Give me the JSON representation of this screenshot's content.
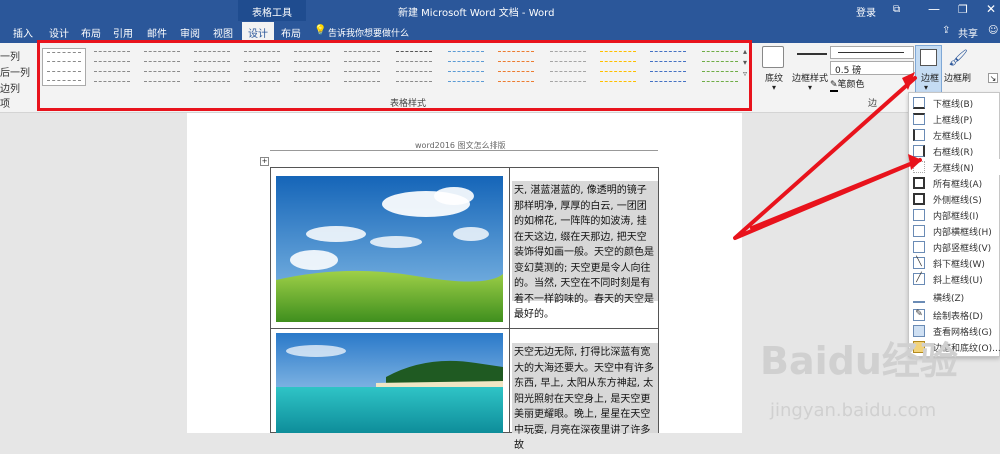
{
  "titlebar": {
    "context_label": "表格工具",
    "document_title": "新建 Microsoft Word 文档 - Word",
    "login": "登录"
  },
  "tabs": [
    "插入",
    "设计",
    "布局",
    "引用",
    "邮件",
    "审阅",
    "视图"
  ],
  "context_tabs": {
    "design": "设计",
    "layout": "布局"
  },
  "tell_me": "告诉我你想要做什么",
  "share": "共享",
  "table_style_options": [
    "一列",
    "后一列",
    "边列",
    "项"
  ],
  "ribbon": {
    "table_styles_group": "表格样式",
    "shading": "底纹",
    "border_styles": "边框样式",
    "weight": "0.5 磅",
    "pen_color": "笔颜色",
    "borders": "边框",
    "border_painter": "边框刷",
    "borders_group_abbrev": "边"
  },
  "border_menu": [
    "下框线(B)",
    "上框线(P)",
    "左框线(L)",
    "右框线(R)",
    "无框线(N)",
    "所有框线(A)",
    "外侧框线(S)",
    "内部框线(I)",
    "内部横框线(H)",
    "内部竖框线(V)",
    "斜下框线(W)",
    "斜上框线(U)",
    "横线(Z)",
    "绘制表格(D)",
    "查看网格线(G)",
    "边框和底纹(O)..."
  ],
  "document": {
    "header": "word2016 图文怎么排版",
    "para1": "天, 湛蓝湛蓝的, 像透明的镜子那样明净, 厚厚的白云, 一团团的如棉花, 一阵阵的如波涛, 挂在天这边, 缀在天那边, 把天空装饰得如画一般。天空的颜色是变幻莫测的; 天空更是令人向往的。当然, 天空在不同时刻是有着不一样韵味的。春天的天空是最好的。",
    "para2": "天空无边无际, 打得比深蓝有宽大的大海还要大。天空中有许多东西, 早上, 太阳从东方神起, 太阳光照射在天空身上, 是天空更美丽更耀眼。晚上, 星星在天空中玩耍, 月亮在深夜里讲了许多故"
  },
  "watermark": {
    "brand": "Baidu经验",
    "url": "jingyan.baidu.com"
  },
  "colors": {
    "ribbon_blue": "#2b579a",
    "highlight_red": "#e8131c"
  }
}
